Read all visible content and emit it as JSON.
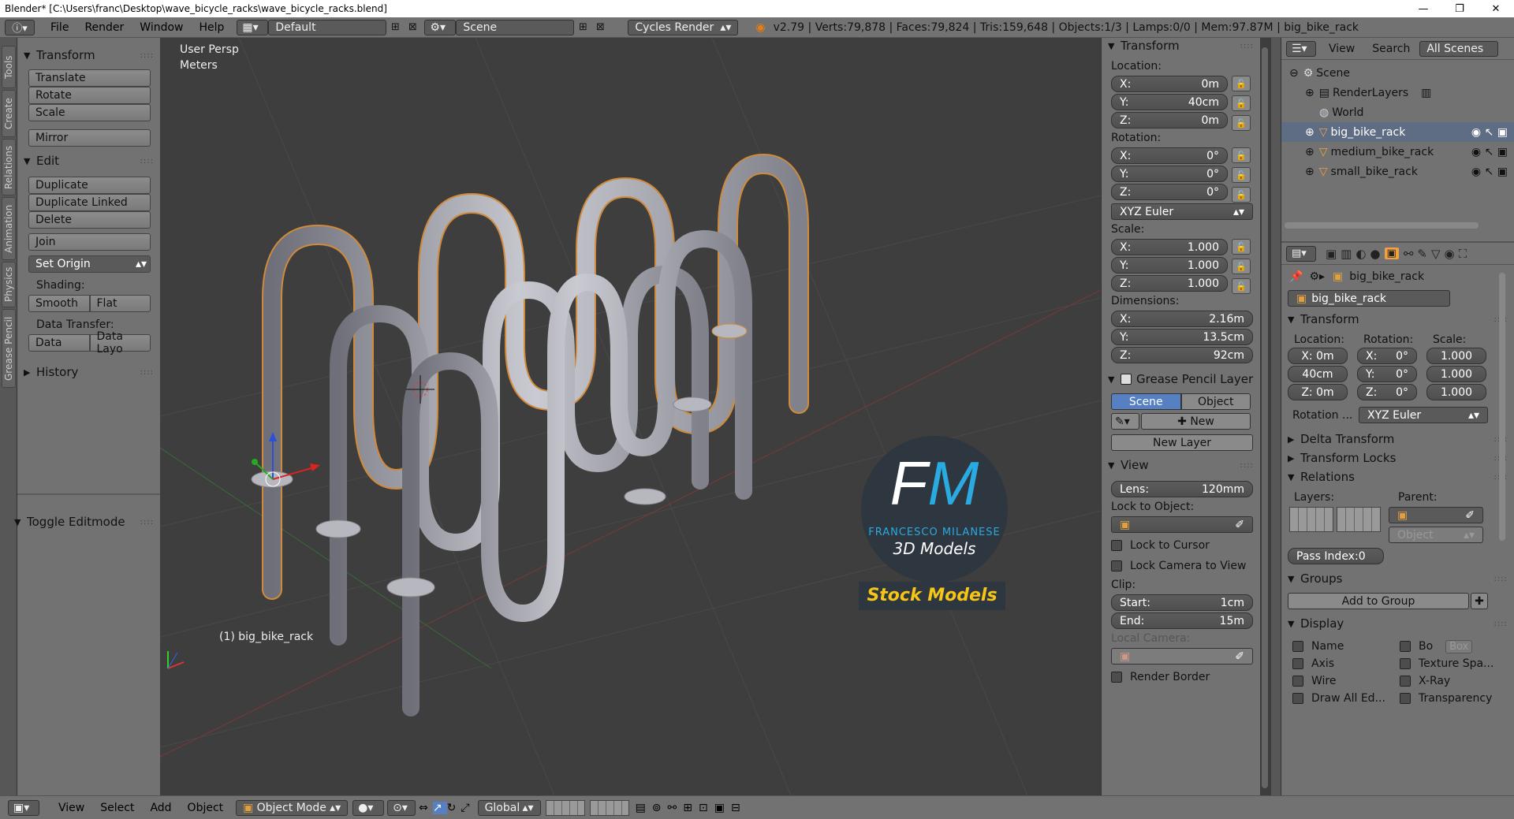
{
  "window": {
    "title": "Blender* [C:\\Users\\franc\\Desktop\\wave_bicycle_racks\\wave_bicycle_racks.blend]"
  },
  "topbar": {
    "menus": [
      "File",
      "Render",
      "Window",
      "Help"
    ],
    "layout": "Default",
    "scene": "Scene",
    "engine": "Cycles Render",
    "stats": "v2.79 | Verts:79,878 | Faces:79,824 | Tris:159,648 | Objects:1/3 | Lamps:0/0 | Mem:97.87M | big_bike_rack"
  },
  "tooltabs": [
    "Tools",
    "Create",
    "Relations",
    "Animation",
    "Physics",
    "Grease Pencil"
  ],
  "toolshelf": {
    "transform_title": "Transform",
    "translate": "Translate",
    "rotate": "Rotate",
    "scale": "Scale",
    "mirror": "Mirror",
    "edit_title": "Edit",
    "duplicate": "Duplicate",
    "duplicate_linked": "Duplicate Linked",
    "delete": "Delete",
    "join": "Join",
    "set_origin": "Set Origin",
    "shading_label": "Shading:",
    "smooth": "Smooth",
    "flat": "Flat",
    "data_transfer_label": "Data Transfer:",
    "data": "Data",
    "data_layo": "Data Layo",
    "history": "History",
    "toggle_editmode": "Toggle Editmode"
  },
  "viewport": {
    "view_name": "User Persp",
    "units": "Meters",
    "object_label": "(1) big_bike_rack",
    "watermark": {
      "logo": "FM",
      "line1": "FRANCESCO MILANESE",
      "line2": "3D Models",
      "stock": "Stock Models"
    }
  },
  "npanel": {
    "transform_title": "Transform",
    "location_label": "Location:",
    "location": [
      {
        "k": "X:",
        "v": "0m"
      },
      {
        "k": "Y:",
        "v": "40cm"
      },
      {
        "k": "Z:",
        "v": "0m"
      }
    ],
    "rotation_label": "Rotation:",
    "rotation": [
      {
        "k": "X:",
        "v": "0°"
      },
      {
        "k": "Y:",
        "v": "0°"
      },
      {
        "k": "Z:",
        "v": "0°"
      }
    ],
    "rotation_mode": "XYZ Euler",
    "scale_label": "Scale:",
    "scale": [
      {
        "k": "X:",
        "v": "1.000"
      },
      {
        "k": "Y:",
        "v": "1.000"
      },
      {
        "k": "Z:",
        "v": "1.000"
      }
    ],
    "dimensions_label": "Dimensions:",
    "dimensions": [
      {
        "k": "X:",
        "v": "2.16m"
      },
      {
        "k": "Y:",
        "v": "13.5cm"
      },
      {
        "k": "Z:",
        "v": "92cm"
      }
    ],
    "gp_title": "Grease Pencil Layer",
    "gp_scene": "Scene",
    "gp_object": "Object",
    "gp_new": "New",
    "gp_new_layer": "New Layer",
    "view_title": "View",
    "lens_label": "Lens:",
    "lens": "120mm",
    "lock_to_object": "Lock to Object:",
    "lock_to_cursor": "Lock to Cursor",
    "lock_camera": "Lock Camera to View",
    "clip_label": "Clip:",
    "clip_start_label": "Start:",
    "clip_start": "1cm",
    "clip_end_label": "End:",
    "clip_end": "15m",
    "local_camera": "Local Camera:",
    "render_border": "Render Border"
  },
  "outliner": {
    "view": "View",
    "search": "Search",
    "filter": "All Scenes",
    "items": [
      "Scene",
      "RenderLayers",
      "World",
      "big_bike_rack",
      "medium_bike_rack",
      "small_bike_rack"
    ]
  },
  "props": {
    "object_name": "big_bike_rack",
    "name_field": "big_bike_rack",
    "transform_title": "Transform",
    "loc_label": "Location:",
    "rot_label": "Rotation:",
    "scale_label": "Scale:",
    "loc": [
      "X: 0m",
      "40cm",
      "Z: 0m"
    ],
    "rot": [
      "X:",
      "Y:",
      "Z:"
    ],
    "rot_vals": [
      "0°",
      "0°",
      "0°"
    ],
    "scl": [
      "1.000",
      "1.000",
      "1.000"
    ],
    "rotation_mode_label": "Rotation ...",
    "rotation_mode": "XYZ Euler",
    "delta": "Delta Transform",
    "locks": "Transform Locks",
    "relations": "Relations",
    "layers_label": "Layers:",
    "parent_label": "Parent:",
    "parent_type": "Object",
    "pass_index": "Pass Index:0",
    "groups": "Groups",
    "add_to_group": "Add to Group",
    "display": "Display",
    "display_left": [
      "Name",
      "Axis",
      "Wire",
      "Draw All Ed..."
    ],
    "display_right": [
      "Bo",
      "Texture Spa...",
      "X-Ray",
      "Transparency"
    ],
    "bounds_type": "Box"
  },
  "bottombar": {
    "menus": [
      "View",
      "Select",
      "Add",
      "Object"
    ],
    "mode": "Object Mode",
    "orientation": "Global"
  }
}
